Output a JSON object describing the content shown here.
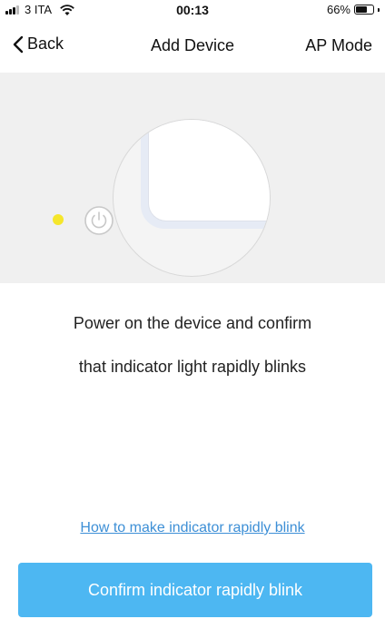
{
  "status_bar": {
    "carrier": "3 ITA",
    "time": "00:13",
    "battery": "66%",
    "battery_level": 0.66
  },
  "nav": {
    "back_label": "Back",
    "title": "Add Device",
    "right_label": "AP Mode"
  },
  "illustration": {
    "indicator_color": "#f5e62b",
    "icon": "power-icon"
  },
  "instructions": {
    "line1": "Power on the device and confirm",
    "line2": "that indicator light rapidly blinks"
  },
  "help_link": "How to make indicator rapidly blink",
  "confirm_button": "Confirm indicator rapidly blink",
  "colors": {
    "accent": "#4db7f2",
    "link": "#3d8fd6"
  }
}
